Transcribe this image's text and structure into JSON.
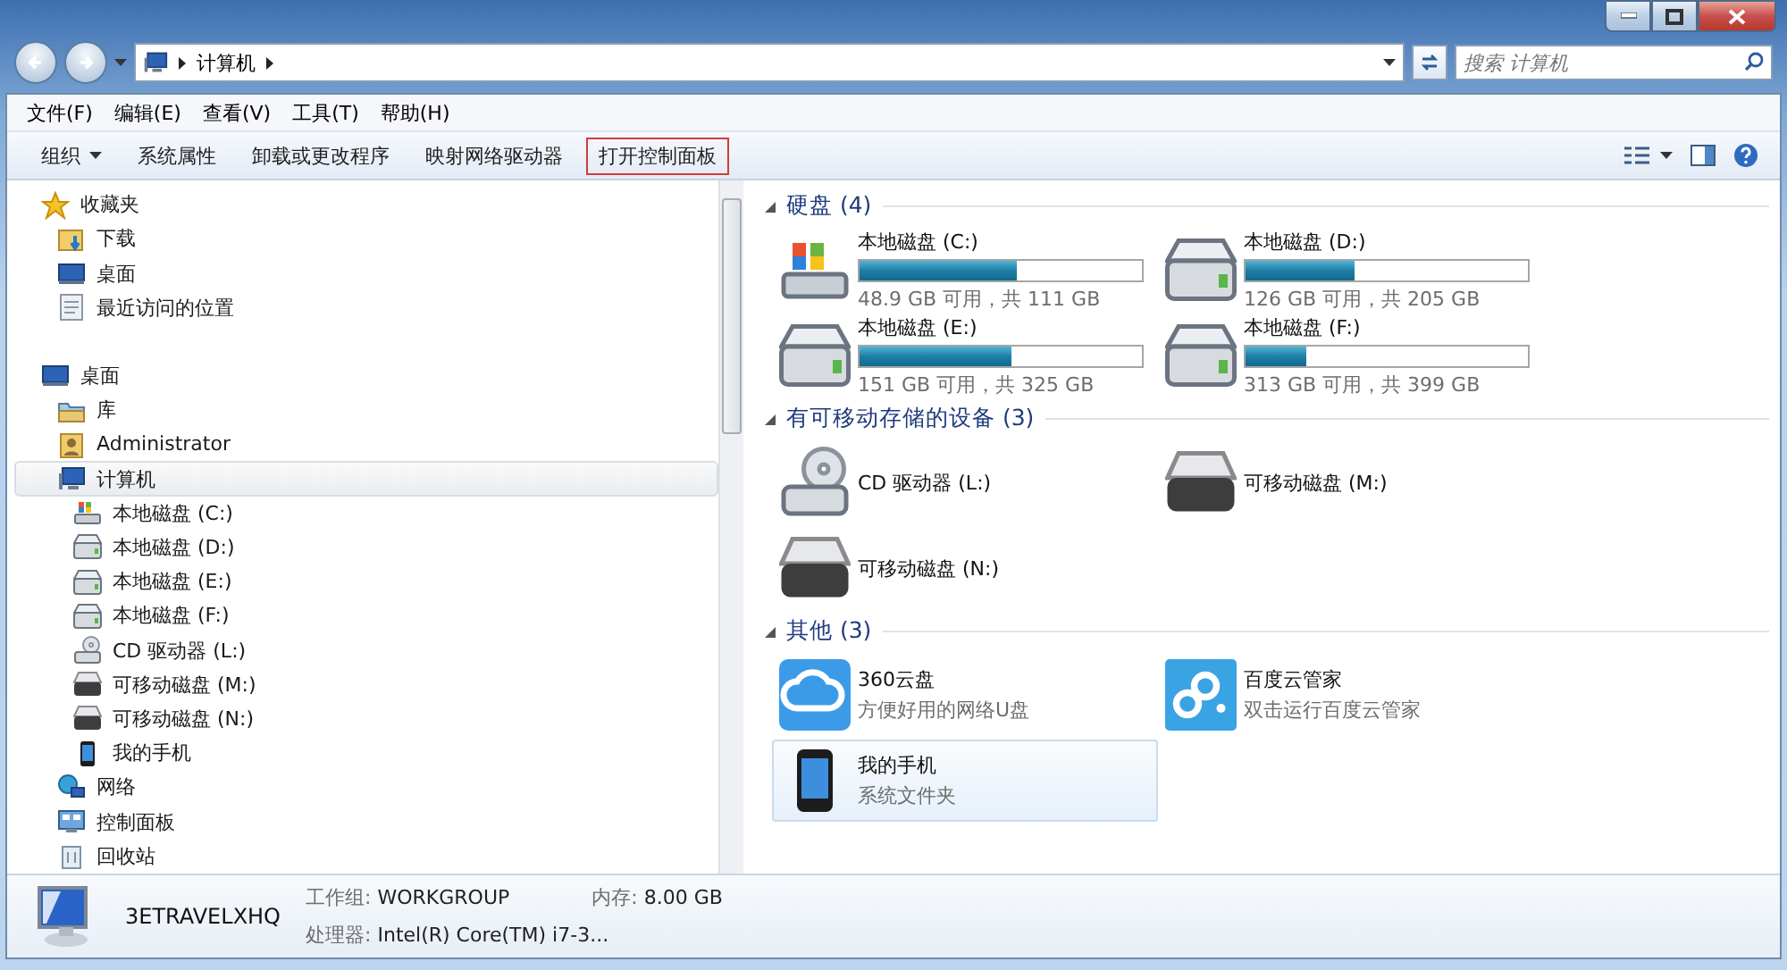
{
  "address_bar": {
    "path": [
      "计算机"
    ],
    "search": {
      "placeholder": "搜索 计算机"
    }
  },
  "menu": [
    "文件(F)",
    "编辑(E)",
    "查看(V)",
    "工具(T)",
    "帮助(H)"
  ],
  "commands": [
    {
      "label": "组织",
      "dropdown": true,
      "highlighted": false
    },
    {
      "label": "系统属性",
      "dropdown": false,
      "highlighted": false
    },
    {
      "label": "卸载或更改程序",
      "dropdown": false,
      "highlighted": false
    },
    {
      "label": "映射网络驱动器",
      "dropdown": false,
      "highlighted": false
    },
    {
      "label": "打开控制面板",
      "dropdown": false,
      "highlighted": true
    }
  ],
  "nav": [
    {
      "label": "收藏夹",
      "kind": "star",
      "selected": false,
      "children": [
        {
          "label": "下载",
          "kind": "download",
          "selected": false
        },
        {
          "label": "桌面",
          "kind": "desktop",
          "selected": false
        },
        {
          "label": "最近访问的位置",
          "kind": "recent",
          "selected": false
        }
      ]
    },
    {
      "label": "桌面",
      "kind": "desktop",
      "selected": false,
      "children": [
        {
          "label": "库",
          "kind": "library",
          "selected": false
        },
        {
          "label": "Administrator",
          "kind": "user",
          "selected": false
        },
        {
          "label": "计算机",
          "kind": "computer",
          "selected": true,
          "children": [
            {
              "label": "本地磁盘 (C:)",
              "kind": "sysdrive",
              "selected": false
            },
            {
              "label": "本地磁盘 (D:)",
              "kind": "drive",
              "selected": false
            },
            {
              "label": "本地磁盘 (E:)",
              "kind": "drive",
              "selected": false
            },
            {
              "label": "本地磁盘 (F:)",
              "kind": "drive",
              "selected": false
            },
            {
              "label": "CD 驱动器 (L:)",
              "kind": "cd",
              "selected": false
            },
            {
              "label": "可移动磁盘 (M:)",
              "kind": "removable",
              "selected": false
            },
            {
              "label": "可移动磁盘 (N:)",
              "kind": "removable",
              "selected": false
            },
            {
              "label": "我的手机",
              "kind": "phone",
              "selected": false
            }
          ]
        },
        {
          "label": "网络",
          "kind": "network",
          "selected": false
        },
        {
          "label": "控制面板",
          "kind": "control",
          "selected": false
        },
        {
          "label": "回收站",
          "kind": "recycle",
          "selected": false
        }
      ]
    }
  ],
  "groups": [
    {
      "title": "硬盘 (4)",
      "items": [
        {
          "kind": "sysdrive",
          "name": "本地磁盘 (C:)",
          "level": 0.56,
          "detail": "48.9 GB 可用，共 111 GB",
          "selected": false
        },
        {
          "kind": "drive",
          "name": "本地磁盘 (D:)",
          "level": 0.385,
          "detail": "126 GB 可用，共 205 GB",
          "selected": false
        },
        {
          "kind": "drive",
          "name": "本地磁盘 (E:)",
          "level": 0.535,
          "detail": "151 GB 可用，共 325 GB",
          "selected": false
        },
        {
          "kind": "drive",
          "name": "本地磁盘 (F:)",
          "level": 0.216,
          "detail": "313 GB 可用，共 399 GB",
          "selected": false
        }
      ]
    },
    {
      "title": "有可移动存储的设备 (3)",
      "items": [
        {
          "kind": "cd",
          "name": "CD 驱动器 (L:)",
          "selected": false
        },
        {
          "kind": "removable",
          "name": "可移动磁盘 (M:)",
          "selected": false
        },
        {
          "kind": "removable",
          "name": "可移动磁盘 (N:)",
          "selected": false
        }
      ]
    },
    {
      "title": "其他 (3)",
      "items": [
        {
          "kind": "cloud360",
          "name": "360云盘",
          "detail": "方便好用的网络U盘",
          "selected": false
        },
        {
          "kind": "baidu",
          "name": "百度云管家",
          "detail": "双击运行百度云管家",
          "selected": false
        },
        {
          "kind": "phone",
          "name": "我的手机",
          "detail": "系统文件夹",
          "selected": true
        }
      ]
    }
  ],
  "details": {
    "name": "3ETRAVELXHQ",
    "fields": [
      {
        "label": "工作组:",
        "value": "WORKGROUP"
      },
      {
        "label": "内存:",
        "value": "8.00 GB"
      },
      {
        "label": "处理器:",
        "value": "Intel(R) Core(TM) i7-3..."
      }
    ]
  }
}
